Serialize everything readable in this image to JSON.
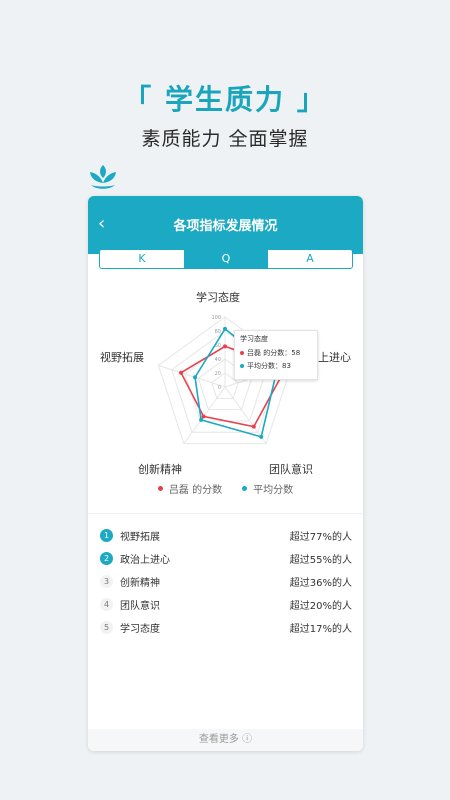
{
  "hero": {
    "title": "「 学生质力 」",
    "subtitle": "素质能力  全面掌握"
  },
  "header": {
    "back_icon": "‹",
    "title": "各项指标发展情况"
  },
  "tabs": [
    {
      "label": "K",
      "active": false
    },
    {
      "label": "Q",
      "active": true
    },
    {
      "label": "A",
      "active": false
    }
  ],
  "radar": {
    "axes": [
      "学习态度",
      "政治上进心",
      "团队意识",
      "创新精神",
      "视野拓展"
    ],
    "ticks": [
      "100",
      "80",
      "60",
      "40",
      "20",
      "0"
    ],
    "series": [
      {
        "name": "吕磊 的分数",
        "color": "#e8414d",
        "values": [
          58,
          92,
          70,
          52,
          66
        ]
      },
      {
        "name": "平均分数",
        "color": "#1ba9c3",
        "values": [
          83,
          78,
          88,
          58,
          45
        ]
      }
    ]
  },
  "tooltip": {
    "title": "学习态度",
    "rows": [
      {
        "label": "吕磊 的分数：",
        "value": "58"
      },
      {
        "label": "平均分数：",
        "value": "83"
      }
    ]
  },
  "legend": [
    "吕磊  的分数",
    "平均分数"
  ],
  "ranking": [
    {
      "rank": "1",
      "name": "视野拓展",
      "value": "超过77%的人"
    },
    {
      "rank": "2",
      "name": "政治上进心",
      "value": "超过55%的人"
    },
    {
      "rank": "3",
      "name": "创新精神",
      "value": "超过36%的人"
    },
    {
      "rank": "4",
      "name": "团队意识",
      "value": "超过20%的人"
    },
    {
      "rank": "5",
      "name": "学习态度",
      "value": "超过17%的人"
    }
  ],
  "footer": {
    "label": "查看更多 ⓘ"
  },
  "colors": {
    "accent": "#1ba9c3",
    "red": "#e8414d"
  }
}
